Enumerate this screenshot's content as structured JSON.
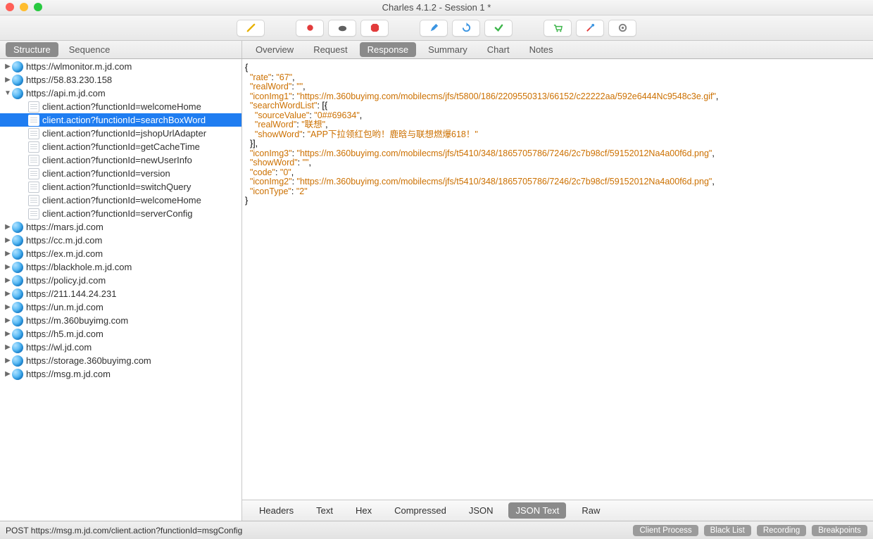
{
  "window": {
    "title": "Charles 4.1.2 - Session 1 *"
  },
  "leftTabs": [
    {
      "label": "Structure",
      "active": true
    },
    {
      "label": "Sequence",
      "active": false
    }
  ],
  "rightTabs": [
    {
      "label": "Overview",
      "active": false
    },
    {
      "label": "Request",
      "active": false
    },
    {
      "label": "Response",
      "active": true
    },
    {
      "label": "Summary",
      "active": false
    },
    {
      "label": "Chart",
      "active": false
    },
    {
      "label": "Notes",
      "active": false
    }
  ],
  "tree": [
    {
      "type": "host",
      "disclosure": "▶",
      "label": "https://wlmonitor.m.jd.com"
    },
    {
      "type": "host",
      "disclosure": "▶",
      "label": "https://58.83.230.158"
    },
    {
      "type": "host",
      "disclosure": "▼",
      "label": "https://api.m.jd.com"
    },
    {
      "type": "child",
      "label": "client.action?functionId=welcomeHome"
    },
    {
      "type": "child",
      "label": "client.action?functionId=searchBoxWord",
      "selected": true
    },
    {
      "type": "child",
      "label": "client.action?functionId=jshopUrlAdapter"
    },
    {
      "type": "child",
      "label": "client.action?functionId=getCacheTime"
    },
    {
      "type": "child",
      "label": "client.action?functionId=newUserInfo"
    },
    {
      "type": "child",
      "label": "client.action?functionId=version"
    },
    {
      "type": "child",
      "label": "client.action?functionId=switchQuery"
    },
    {
      "type": "child",
      "label": "client.action?functionId=welcomeHome"
    },
    {
      "type": "child",
      "label": "client.action?functionId=serverConfig"
    },
    {
      "type": "host",
      "disclosure": "▶",
      "label": "https://mars.jd.com"
    },
    {
      "type": "host",
      "disclosure": "▶",
      "label": "https://cc.m.jd.com"
    },
    {
      "type": "host",
      "disclosure": "▶",
      "label": "https://ex.m.jd.com"
    },
    {
      "type": "host",
      "disclosure": "▶",
      "label": "https://blackhole.m.jd.com"
    },
    {
      "type": "host",
      "disclosure": "▶",
      "label": "https://policy.jd.com"
    },
    {
      "type": "host",
      "disclosure": "▶",
      "label": "https://211.144.24.231"
    },
    {
      "type": "host",
      "disclosure": "▶",
      "label": "https://un.m.jd.com"
    },
    {
      "type": "host",
      "disclosure": "▶",
      "label": "https://m.360buyimg.com"
    },
    {
      "type": "host",
      "disclosure": "▶",
      "label": "https://h5.m.jd.com"
    },
    {
      "type": "host",
      "disclosure": "▶",
      "label": "https://wl.jd.com"
    },
    {
      "type": "host",
      "disclosure": "▶",
      "label": "https://storage.360buyimg.com"
    },
    {
      "type": "host",
      "disclosure": "▶",
      "label": "https://msg.m.jd.com"
    }
  ],
  "jsonLines": [
    [
      [
        "p",
        "{"
      ]
    ],
    [
      [
        "p",
        "  "
      ],
      [
        "k",
        "\"rate\""
      ],
      [
        "p",
        ": "
      ],
      [
        "v",
        "\"67\""
      ],
      [
        "p",
        ","
      ]
    ],
    [
      [
        "p",
        "  "
      ],
      [
        "k",
        "\"realWord\""
      ],
      [
        "p",
        ": "
      ],
      [
        "v",
        "\"\""
      ],
      [
        "p",
        ","
      ]
    ],
    [
      [
        "p",
        "  "
      ],
      [
        "k",
        "\"iconImg1\""
      ],
      [
        "p",
        ": "
      ],
      [
        "v",
        "\"https://m.360buyimg.com/mobilecms/jfs/t5800/186/2209550313/66152/c22222aa/592e6444Nc9548c3e.gif\""
      ],
      [
        "p",
        ","
      ]
    ],
    [
      [
        "p",
        "  "
      ],
      [
        "k",
        "\"searchWordList\""
      ],
      [
        "p",
        ": [{"
      ]
    ],
    [
      [
        "p",
        "    "
      ],
      [
        "k",
        "\"sourceValue\""
      ],
      [
        "p",
        ": "
      ],
      [
        "v",
        "\"0##69634\""
      ],
      [
        "p",
        ","
      ]
    ],
    [
      [
        "p",
        "    "
      ],
      [
        "k",
        "\"realWord\""
      ],
      [
        "p",
        ": "
      ],
      [
        "v",
        "\"联想\""
      ],
      [
        "p",
        ","
      ]
    ],
    [
      [
        "p",
        "    "
      ],
      [
        "k",
        "\"showWord\""
      ],
      [
        "p",
        ": "
      ],
      [
        "v",
        "\"APP下拉领红包哟！鹿晗与联想燃爆618！\""
      ]
    ],
    [
      [
        "p",
        "  }],"
      ]
    ],
    [
      [
        "p",
        "  "
      ],
      [
        "k",
        "\"iconImg3\""
      ],
      [
        "p",
        ": "
      ],
      [
        "v",
        "\"https://m.360buyimg.com/mobilecms/jfs/t5410/348/1865705786/7246/2c7b98cf/59152012Na4a00f6d.png\""
      ],
      [
        "p",
        ","
      ]
    ],
    [
      [
        "p",
        "  "
      ],
      [
        "k",
        "\"showWord\""
      ],
      [
        "p",
        ": "
      ],
      [
        "v",
        "\"\""
      ],
      [
        "p",
        ","
      ]
    ],
    [
      [
        "p",
        "  "
      ],
      [
        "k",
        "\"code\""
      ],
      [
        "p",
        ": "
      ],
      [
        "v",
        "\"0\""
      ],
      [
        "p",
        ","
      ]
    ],
    [
      [
        "p",
        "  "
      ],
      [
        "k",
        "\"iconImg2\""
      ],
      [
        "p",
        ": "
      ],
      [
        "v",
        "\"https://m.360buyimg.com/mobilecms/jfs/t5410/348/1865705786/7246/2c7b98cf/59152012Na4a00f6d.png\""
      ],
      [
        "p",
        ","
      ]
    ],
    [
      [
        "p",
        "  "
      ],
      [
        "k",
        "\"iconType\""
      ],
      [
        "p",
        ": "
      ],
      [
        "v",
        "\"2\""
      ]
    ],
    [
      [
        "p",
        "}"
      ]
    ]
  ],
  "bottomTabs": [
    {
      "label": "Headers",
      "active": false
    },
    {
      "label": "Text",
      "active": false
    },
    {
      "label": "Hex",
      "active": false
    },
    {
      "label": "Compressed",
      "active": false
    },
    {
      "label": "JSON",
      "active": false
    },
    {
      "label": "JSON Text",
      "active": true
    },
    {
      "label": "Raw",
      "active": false
    }
  ],
  "status": {
    "left": "POST https://msg.m.jd.com/client.action?functionId=msgConfig",
    "pills": [
      "Client Process",
      "Black List",
      "Recording",
      "Breakpoints"
    ]
  },
  "toolbarIcons": [
    "broom",
    "record",
    "turtle",
    "stop",
    "pencil",
    "refresh",
    "check",
    "cart",
    "tools",
    "gear"
  ]
}
